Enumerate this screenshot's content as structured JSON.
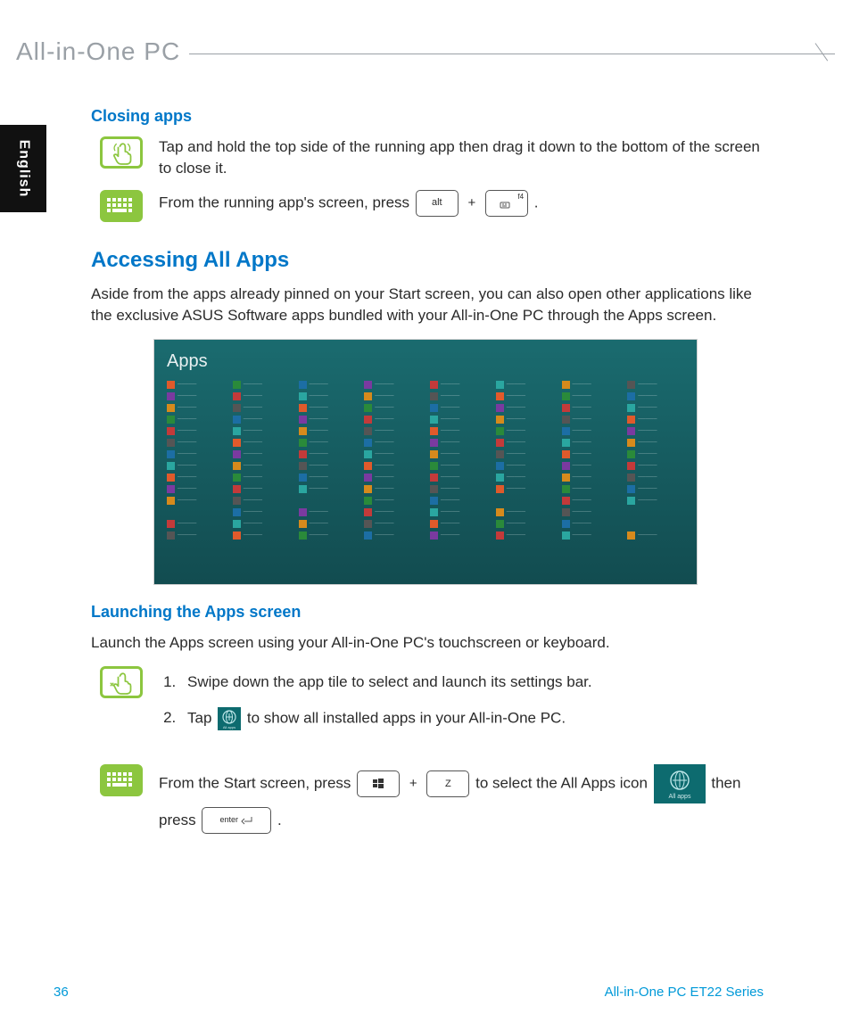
{
  "header": {
    "title": "All-in-One PC"
  },
  "lang_tab": "English",
  "section_closing": {
    "heading": "Closing apps",
    "touch_text": "Tap and hold the top side of the running app then drag it down to the bottom of the screen to close it.",
    "keyboard_prefix": "From the running app's screen, press ",
    "key_alt": "alt",
    "key_f4_label": "f4",
    "period": "."
  },
  "section_allapps": {
    "heading": "Accessing All Apps",
    "intro": "Aside from the apps already pinned on your Start screen, you can also open other applications like the exclusive ASUS Software apps bundled with your All-in-One PC through the Apps screen.",
    "screenshot_title": "Apps"
  },
  "section_launch": {
    "heading": "Launching the Apps screen",
    "intro": "Launch the Apps screen using your All-in-One PC's touchscreen or keyboard.",
    "step1": "Swipe down the app tile to select and launch its settings bar.",
    "step2_prefix": "Tap ",
    "step2_suffix": " to show all installed apps in your All-in-One PC.",
    "kb_prefix": "From the Start screen, press ",
    "kb_mid": " to select the All Apps icon ",
    "kb_then": " then press ",
    "key_z": "Z",
    "key_enter": "enter",
    "period": ".",
    "allapps_label": "All apps"
  },
  "footer": {
    "page_no": "36",
    "series": "All-in-One PC ET22 Series"
  },
  "app_tile_colors": [
    "#e05a2b",
    "#2a8a3a",
    "#1c6ea4",
    "#7a3aa0",
    "#c33a3a",
    "#2aa6a0",
    "#d68a1c",
    "#555555"
  ]
}
